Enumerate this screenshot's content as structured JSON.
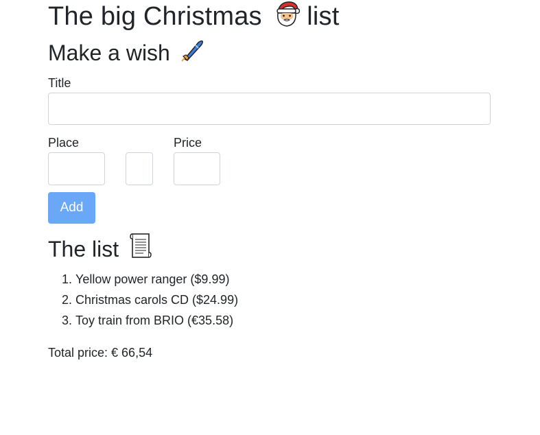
{
  "header": {
    "title": "The big Christmas",
    "title_suffix": "list",
    "title_icon": "santa-icon"
  },
  "wish_form": {
    "heading": "Make a wish",
    "heading_icon": "rocket-icon",
    "title_label": "Title",
    "title_value": "",
    "place_label": "Place",
    "place_value": "",
    "extra_value": "",
    "price_label": "Price",
    "price_value": "",
    "add_label": "Add",
    "add_color": "#6aa8f7"
  },
  "list": {
    "heading": "The list",
    "heading_icon": "scroll-icon",
    "items": [
      "Yellow power ranger ($9.99)",
      "Christmas carols CD ($24.99)",
      "Toy train from BRIO (€35.58)"
    ]
  },
  "total": {
    "text": "Total price: € 66,54"
  }
}
